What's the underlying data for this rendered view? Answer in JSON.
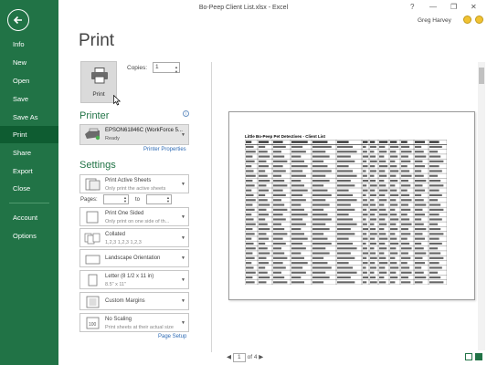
{
  "window": {
    "title": "Bo-Peep Client List.xlsx - Excel",
    "user": "Greg Harvey"
  },
  "nav": {
    "items": [
      "Info",
      "New",
      "Open",
      "Save",
      "Save As",
      "Print",
      "Share",
      "Export",
      "Close",
      "Account",
      "Options"
    ],
    "active": "Print"
  },
  "print": {
    "heading": "Print",
    "button_label": "Print",
    "copies_label": "Copies:",
    "copies_value": "1"
  },
  "printer": {
    "heading": "Printer",
    "name": "EPSON61846C (WorkForce 5...",
    "status": "Ready",
    "properties_link": "Printer Properties"
  },
  "settings": {
    "heading": "Settings",
    "what_main": "Print Active Sheets",
    "what_sub": "Only print the active sheets",
    "pages_label": "Pages:",
    "to_label": "to",
    "sided_main": "Print One Sided",
    "sided_sub": "Only print on one side of th...",
    "collate_main": "Collated",
    "collate_sub": "1,2,3   1,2,3   1,2,3",
    "orientation": "Landscape Orientation",
    "paper_main": "Letter (8 1/2 x 11 in)",
    "paper_sub": "8.5\" x 11\"",
    "margins": "Custom Margins",
    "scaling_main": "No Scaling",
    "scaling_sub": "Print sheets at their actual size",
    "page_setup_link": "Page Setup"
  },
  "preview": {
    "sheet_title": "Little Bo-Peep Pet Detectives - Client List",
    "current_page": "1",
    "page_of": "of 4"
  },
  "colors": {
    "accent": "#217346",
    "active_nav": "#0e5c31",
    "link": "#2e6bb5"
  }
}
